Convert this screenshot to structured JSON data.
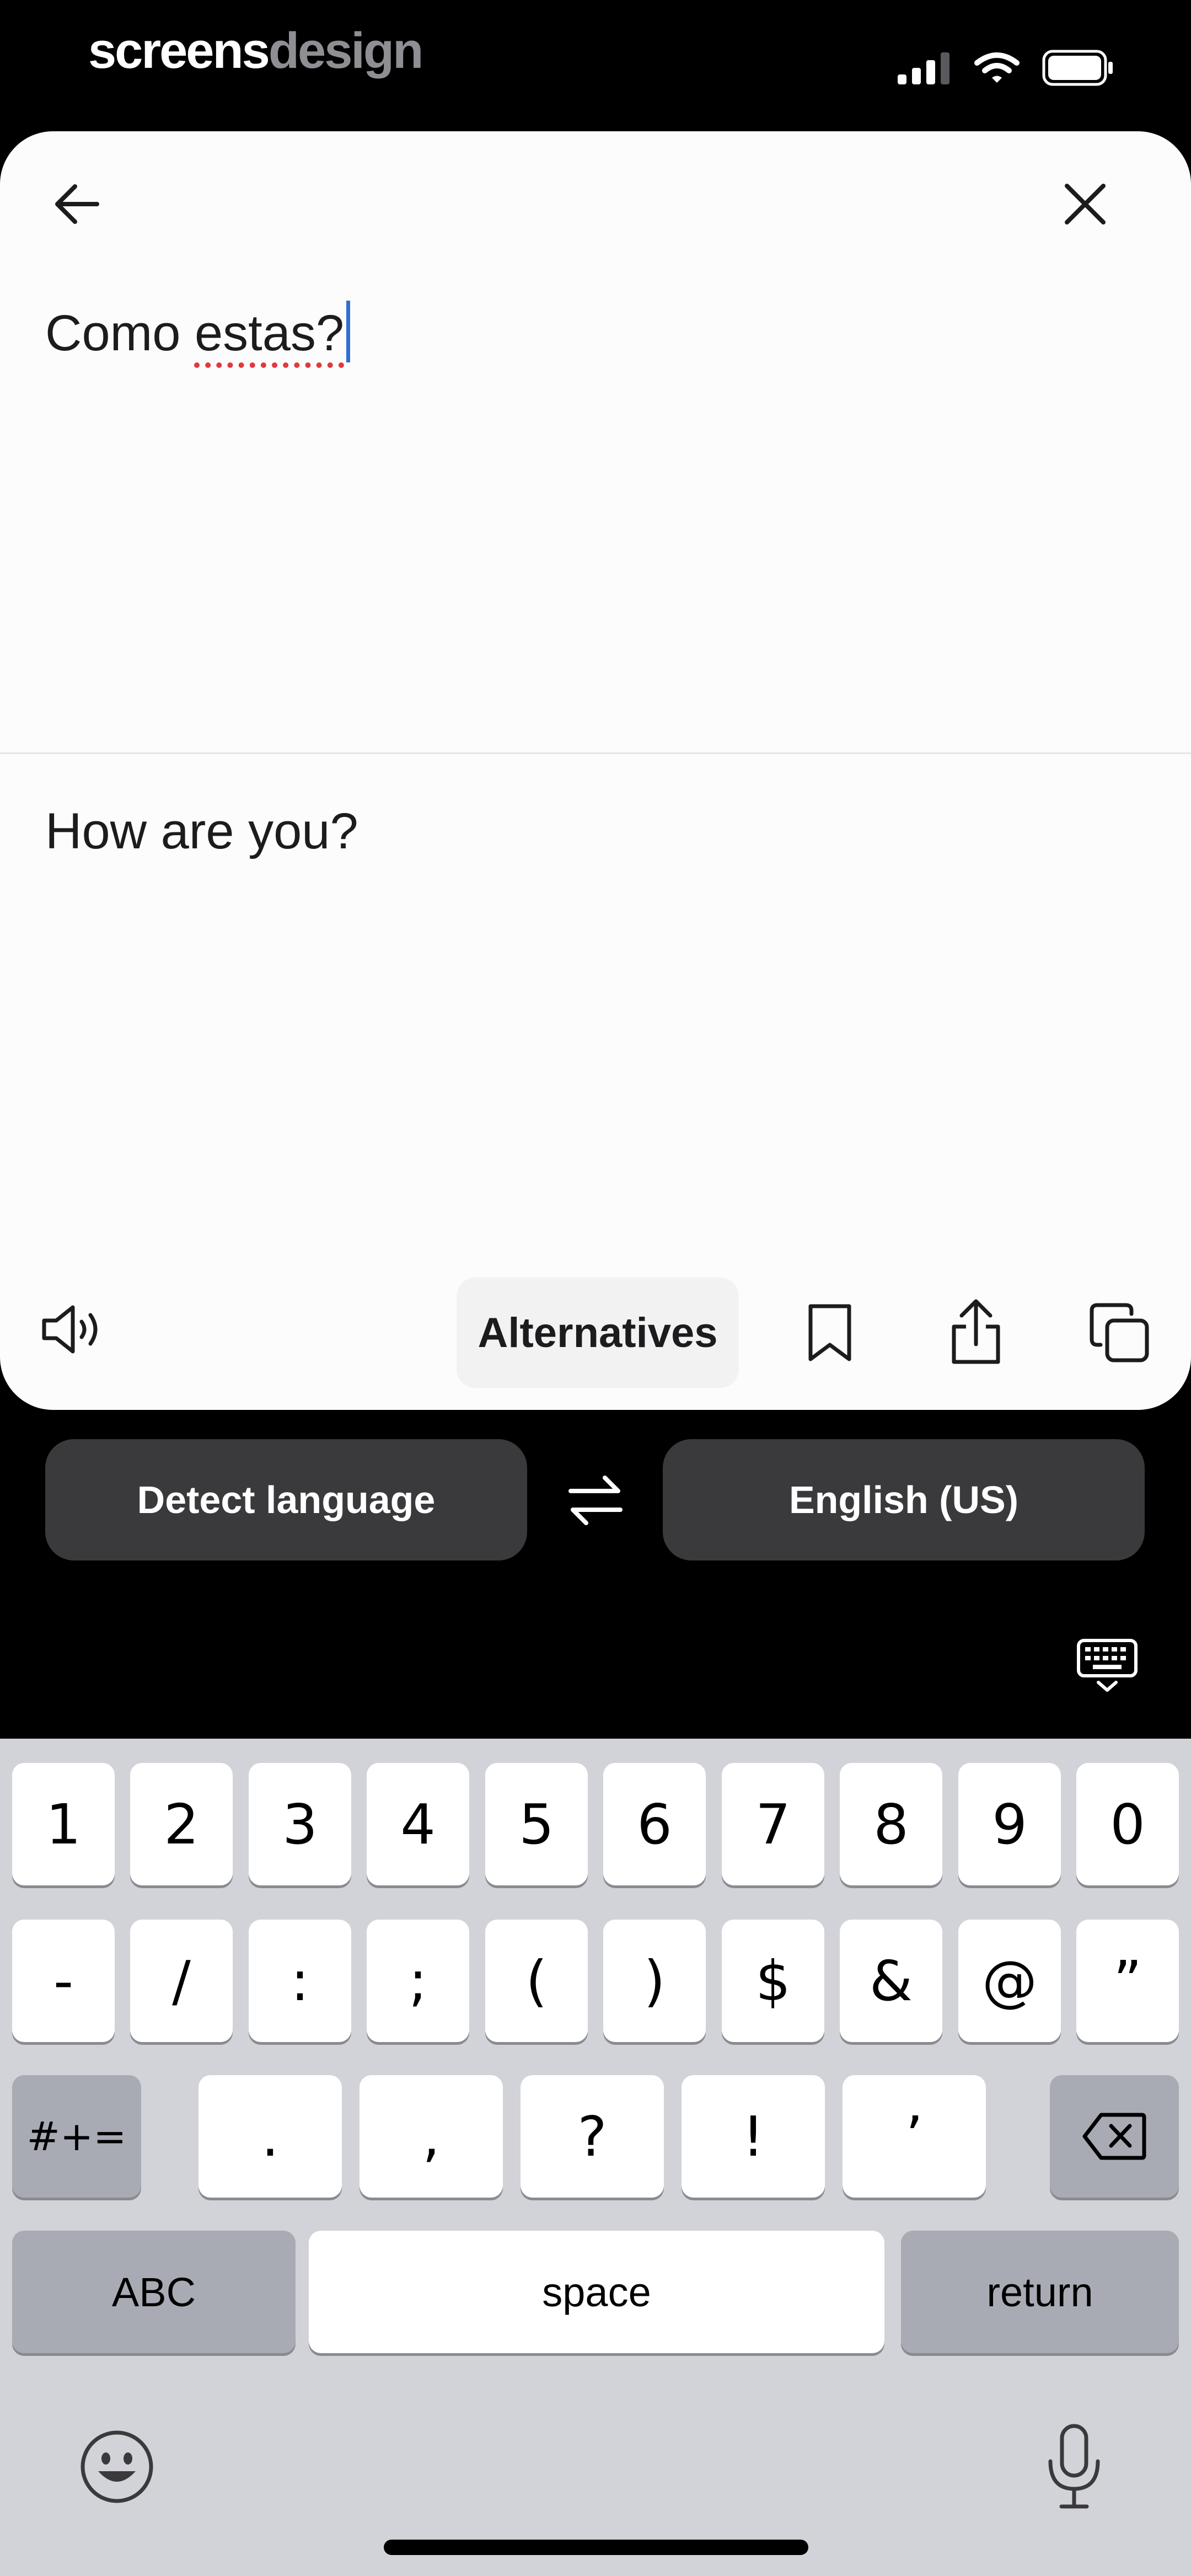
{
  "status_bar": {
    "brand_part1": "screens",
    "brand_part2": "design",
    "icons": [
      "signal-icon",
      "wifi-icon",
      "battery-icon"
    ]
  },
  "header": {
    "back_icon": "arrow-left-icon",
    "close_icon": "close-icon"
  },
  "source": {
    "text_before": "Como ",
    "text_misspelled": "estas?",
    "spellcheck_color": "#e0393e",
    "caret_color": "#2f6fd6"
  },
  "translation": {
    "text": "How are you?"
  },
  "actions": {
    "alternatives_label": "Alternatives",
    "icons": [
      "speaker-icon",
      "bookmark-icon",
      "share-icon",
      "copy-icon"
    ]
  },
  "languages": {
    "source_label": "Detect language",
    "target_label": "English (US)",
    "swap_icon": "swap-arrows-icon",
    "keyboard_icon": "keyboard-hide-icon"
  },
  "keyboard": {
    "row1": [
      "1",
      "2",
      "3",
      "4",
      "5",
      "6",
      "7",
      "8",
      "9",
      "0"
    ],
    "row2": [
      "-",
      "/",
      ":",
      ";",
      "(",
      ")",
      "$",
      "&",
      "@",
      "”"
    ],
    "row3_left": "#+=",
    "row3": [
      ".",
      ",",
      "?",
      "!",
      "’"
    ],
    "abc_label": "ABC",
    "space_label": "space",
    "return_label": "return",
    "emoji_icon": "emoji-icon",
    "mic_icon": "microphone-icon",
    "delete_icon": "backspace-icon"
  },
  "colors": {
    "background": "#000000",
    "card": "#fdfcfd",
    "pill": "#3a393b",
    "keyboard_bg": "#d2d3d8",
    "key_dark": "#a9abb4"
  }
}
